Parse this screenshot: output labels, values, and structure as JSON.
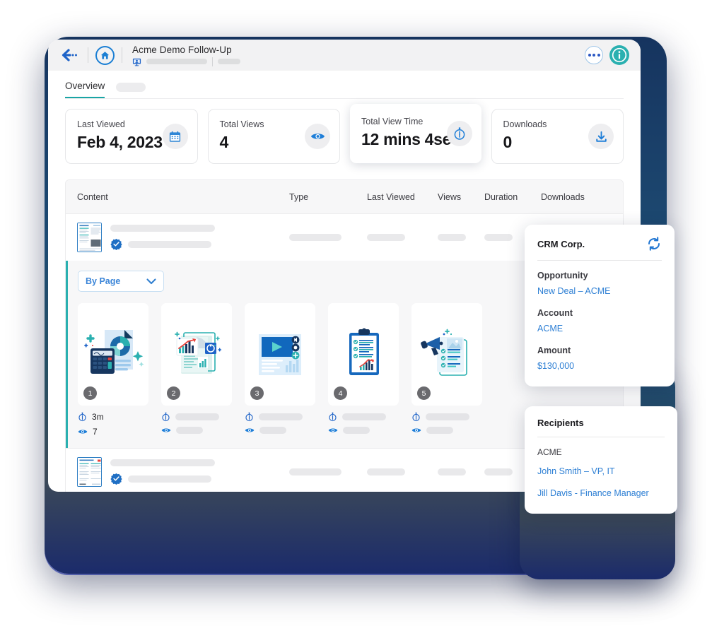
{
  "topbar": {
    "back_icon": "arrow-left-icon",
    "home_icon": "home-icon",
    "doc_title": "Acme Demo Follow-Up",
    "presenter_icon": "presenter-icon",
    "more_icon": "more-horizontal-icon",
    "info_icon": "info-circle-icon"
  },
  "tabs": {
    "overview": "Overview"
  },
  "stats": [
    {
      "label": "Last Viewed",
      "value": "Feb 4, 2023",
      "icon": "calendar-icon",
      "raised": false
    },
    {
      "label": "Total Views",
      "value": "4",
      "icon": "eye-icon",
      "raised": false
    },
    {
      "label": "Total View Time",
      "value": "12 mins 4sec",
      "icon": "stopwatch-icon",
      "raised": true
    },
    {
      "label": "Downloads",
      "value": "0",
      "icon": "download-icon",
      "raised": false
    }
  ],
  "table": {
    "columns": [
      "Content",
      "Type",
      "Last Viewed",
      "Views",
      "Duration",
      "Downloads"
    ]
  },
  "pagepanel": {
    "dropdown_label": "By Page",
    "dropdown_icon": "chevron-down-icon",
    "pages": [
      {
        "number": "1",
        "art": "calculator-report",
        "duration": "3m",
        "views": "7"
      },
      {
        "number": "2",
        "art": "chart-document",
        "duration": "",
        "views": ""
      },
      {
        "number": "3",
        "art": "video-player",
        "duration": "",
        "views": ""
      },
      {
        "number": "4",
        "art": "clipboard-chart",
        "duration": "",
        "views": ""
      },
      {
        "number": "5",
        "art": "megaphone-list",
        "duration": "",
        "views": ""
      }
    ],
    "duration_icon": "stopwatch-icon",
    "views_icon": "eye-icon"
  },
  "crm_card": {
    "title": "CRM Corp.",
    "refresh_icon": "refresh-icon",
    "fields": [
      {
        "label": "Opportunity",
        "value": "New Deal – ACME"
      },
      {
        "label": "Account",
        "value": "ACME"
      },
      {
        "label": "Amount",
        "value": "$130,000"
      }
    ]
  },
  "recipients_card": {
    "title": "Recipients",
    "company": "ACME",
    "people": [
      "John Smith – VP, IT",
      "Jill Davis - Finance Manager"
    ]
  },
  "colors": {
    "teal": "#2ab0b0",
    "blue_link": "#2d7fd4",
    "brand_blue": "#1b7fd4",
    "navy": "#16345f",
    "topbar_bg": "#f2f2f3"
  }
}
